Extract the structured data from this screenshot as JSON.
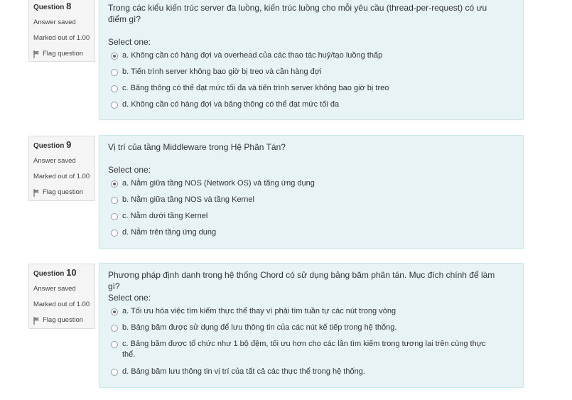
{
  "questions": [
    {
      "label": "Question",
      "number": "8",
      "state": "Answer saved",
      "marks": "Marked out of 1.00",
      "flag": "Flag question",
      "text": "Trong các kiểu kiến trúc server đa luồng, kiến trúc luồng cho mỗi yêu cầu (thread-per-request) có ưu điểm gì?",
      "prompt": "Select one:",
      "options": [
        {
          "text": "a. Không cần có hàng đợi và overhead của các thao tác huỷ/tạo luồng thấp",
          "checked": true
        },
        {
          "text": "b. Tiến trình server không bao giờ bị treo và cần hàng đợi",
          "checked": false
        },
        {
          "text": "c. Băng thông có thể đạt mức tối đa và tiến trình server không bao giờ bị treo",
          "checked": false
        },
        {
          "text": "d. Không cần có hàng đợi và băng thông có thể đạt mức tối đa",
          "checked": false
        }
      ]
    },
    {
      "label": "Question",
      "number": "9",
      "state": "Answer saved",
      "marks": "Marked out of 1.00",
      "flag": "Flag question",
      "text": "Vị trí của tầng Middleware trong Hệ Phân Tán?",
      "prompt": "Select one:",
      "options": [
        {
          "text": "a. Nằm giữa tầng NOS (Network OS) và tầng ứng dụng",
          "checked": true
        },
        {
          "text": "b. Nằm giữa tầng NOS và tầng Kernel",
          "checked": false
        },
        {
          "text": "c. Nằm dưới tầng Kernel",
          "checked": false
        },
        {
          "text": "d. Nằm trên tầng ứng dụng",
          "checked": false
        }
      ]
    },
    {
      "label": "Question",
      "number": "10",
      "state": "Answer saved",
      "marks": "Marked out of 1.00",
      "flag": "Flag question",
      "text": "Phương pháp định danh trong hệ thống Chord có sử dụng bảng băm phân tán. Mục đích chính để làm gì?",
      "prompt": "Select one:",
      "options": [
        {
          "text": "a. Tối ưu hóa việc tìm kiếm thực thể thay vì phải tìm tuần tự các nút trong vòng",
          "checked": true
        },
        {
          "text": "b. Bảng băm được sử dụng để lưu thông tin của các nút kế tiếp trong hệ thống.",
          "checked": false
        },
        {
          "text": "c. Bảng băm được tổ chức như 1 bộ đệm, tối ưu hơn cho các lần tìm kiếm trong tương lai trên cùng thực thể.",
          "checked": false
        },
        {
          "text": "d. Bảng băm lưu thông tin vị trí của tất cả các thực thể trong hệ thống.",
          "checked": false
        }
      ]
    }
  ]
}
